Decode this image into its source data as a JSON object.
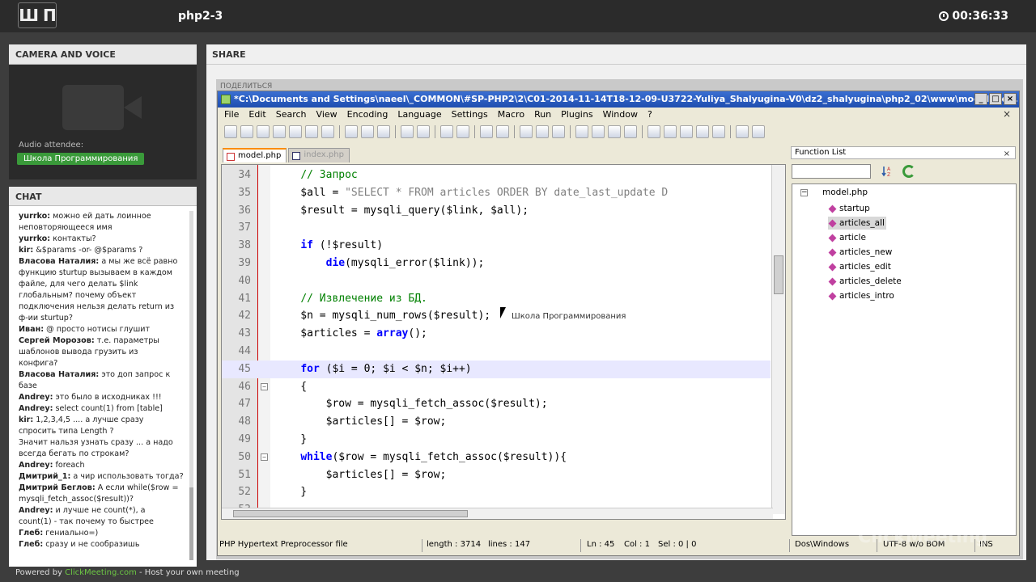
{
  "topbar": {
    "logo": "Ш П",
    "title": "php2-3",
    "timer": "00:36:33"
  },
  "camera": {
    "header": "CAMERA AND VOICE",
    "audio_label": "Audio attendee:",
    "audio_name": "Школа Программирования"
  },
  "chat": {
    "header": "CHAT",
    "messages": [
      {
        "who": "yurrko:",
        "text": " можно ей дать лоинное"
      },
      {
        "who": "",
        "text": "неповторяющееся имя"
      },
      {
        "who": "yurrko:",
        "text": " контакты?"
      },
      {
        "who": "kir:",
        "text": " &$params -or- @$params ?"
      },
      {
        "who": "Власова Наталия:",
        "text": " а мы же всё равно"
      },
      {
        "who": "",
        "text": "функцию sturtup вызываем в каждом"
      },
      {
        "who": "",
        "text": "файле, для чего делать $link"
      },
      {
        "who": "",
        "text": "глобальным? почему объект"
      },
      {
        "who": "",
        "text": "подключения нельзя делать return из"
      },
      {
        "who": "",
        "text": "ф-ии sturtup?"
      },
      {
        "who": "Иван:",
        "text": " @ просто нотисы глушит"
      },
      {
        "who": "Сергей Морозов:",
        "text": " т.е. параметры"
      },
      {
        "who": "",
        "text": "шаблонов вывода грузить из"
      },
      {
        "who": "",
        "text": "конфига?"
      },
      {
        "who": "Власова Наталия:",
        "text": " это доп запрос к"
      },
      {
        "who": "",
        "text": "базе"
      },
      {
        "who": "Andrey:",
        "text": " это было в исходниках !!!"
      },
      {
        "who": "Andrey:",
        "text": " select count(1) from [table]"
      },
      {
        "who": "kir:",
        "text": " 1,2,3,4,5 .... а лучше сразу"
      },
      {
        "who": "",
        "text": "спросить типа Length ?"
      },
      {
        "who": "",
        "text": "Значит нальзя узнать сразу ... а надо"
      },
      {
        "who": "",
        "text": "всегда бегать по строкам?"
      },
      {
        "who": "Andrey:",
        "text": " foreach"
      },
      {
        "who": "Дмитрий_1:",
        "text": " а чир использовать тогда?"
      },
      {
        "who": "Дмитрий Беглов:",
        "text": " А если while($row ="
      },
      {
        "who": "",
        "text": "mysqli_fetch_assoc($result))?"
      },
      {
        "who": "Andrey:",
        "text": " и лучше не count(*), а"
      },
      {
        "who": "",
        "text": "count(1) - так почему то быстрее"
      },
      {
        "who": "Глеб:",
        "text": " гениально=)"
      },
      {
        "who": "Глеб:",
        "text": " сразу и не сообразишь"
      }
    ]
  },
  "footer": {
    "prefix": "Powered by ",
    "brand": "ClickMeeting.com",
    "suffix": " - Host your own meeting"
  },
  "share": {
    "header": "SHARE",
    "behind_title": "ПОДЕЛИТЬСЯ"
  },
  "npp": {
    "title": "*C:\\Documents and Settings\\naeel\\_COMMON\\#SP-PHP2\\2\\C01-2014-11-14T18-12-09-U3722-Yuliya_Shalyugina-V0\\dz2_shalyugina\\php2_02\\www\\model\\mo...",
    "menu": [
      "File",
      "Edit",
      "Search",
      "View",
      "Encoding",
      "Language",
      "Settings",
      "Macro",
      "Run",
      "Plugins",
      "Window",
      "?"
    ],
    "tabs": [
      "model.php",
      "index.php"
    ],
    "code_lines": [
      {
        "n": "34",
        "html": "    <span class='cm'>// Запрос</span>"
      },
      {
        "n": "35",
        "html": "    $all = <span class='str'>\"SELECT * FROM articles ORDER BY date_last_update D</span>"
      },
      {
        "n": "36",
        "html": "    $result = mysqli_query($link, $all);"
      },
      {
        "n": "37",
        "html": ""
      },
      {
        "n": "38",
        "html": "    <span class='kw'>if</span> (!$result)"
      },
      {
        "n": "39",
        "html": "        <span class='kw'>die</span>(mysqli_error($link));"
      },
      {
        "n": "40",
        "html": ""
      },
      {
        "n": "41",
        "html": "    <span class='cm'>// Извлечение из БД.</span>"
      },
      {
        "n": "42",
        "html": "    $n = mysqli_num_rows($result);"
      },
      {
        "n": "43",
        "html": "    $articles = <span class='kw'>array</span>();"
      },
      {
        "n": "44",
        "html": ""
      },
      {
        "n": "45",
        "html": "    <span class='kw'>for</span> ($i = 0; $i &lt; $n; $i++)"
      },
      {
        "n": "46",
        "html": "    {"
      },
      {
        "n": "47",
        "html": "        $row = mysqli_fetch_assoc($result);"
      },
      {
        "n": "48",
        "html": "        $articles[] = $row;"
      },
      {
        "n": "49",
        "html": "    }"
      },
      {
        "n": "50",
        "html": "    <span class='kw'>while</span>($row = mysqli_fetch_assoc($result)){"
      },
      {
        "n": "51",
        "html": "        $articles[] = $row;"
      },
      {
        "n": "52",
        "html": "    }"
      },
      {
        "n": "53",
        "html": ""
      }
    ],
    "current_line": "45",
    "fold_lines": [
      "46",
      "50"
    ],
    "tooltip": "Школа Программирования",
    "function_list": {
      "header": "Function List",
      "root": "model.php",
      "items": [
        "startup",
        "articles_all",
        "article",
        "articles_new",
        "articles_edit",
        "articles_delete",
        "articles_intro"
      ],
      "selected": "articles_all"
    },
    "status": {
      "filetype": "PHP Hypertext Preprocessor file",
      "length": "length : 3714",
      "lines": "lines : 147",
      "ln": "Ln : 45",
      "col": "Col : 1",
      "sel": "Sel : 0 | 0",
      "eol": "Dos\\Windows",
      "enc": "UTF-8 w/o BOM",
      "ins": "INS"
    }
  },
  "watermark": "ClickMeeting",
  "colors": {
    "accent_green": "#3a9a3a",
    "title_blue": "#1f4eb0",
    "keyword": "#0000ff",
    "comment": "#008000"
  }
}
